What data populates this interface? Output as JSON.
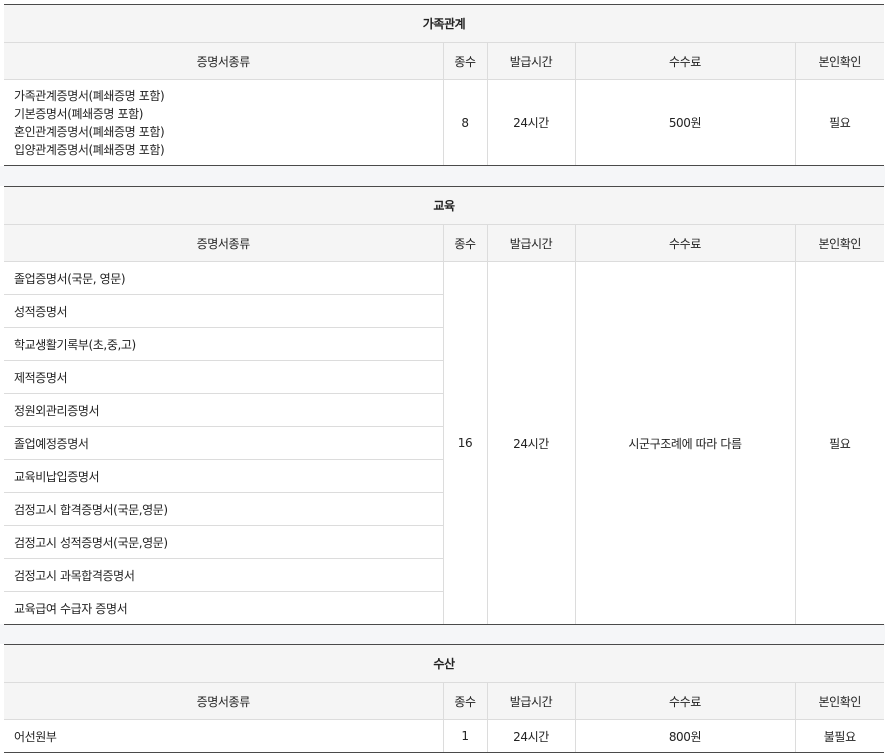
{
  "columns": {
    "doc_type": "증명서종류",
    "count": "종수",
    "issue_time": "발급시간",
    "fee": "수수료",
    "id_check": "본인확인"
  },
  "sections": [
    {
      "title": "가족관계",
      "documents": [
        "가족관계증명서(폐쇄증명 포함)",
        "기본증명서(폐쇄증명 포함)",
        "혼인관계증명서(폐쇄증명 포함)",
        "입양관계증명서(폐쇄증명 포함)"
      ],
      "count": "8",
      "issue_time": "24시간",
      "fee": "500원",
      "id_check": "필요"
    },
    {
      "title": "교육",
      "documents": [
        "졸업증명서(국문, 영문)",
        "성적증명서",
        "학교생활기록부(초,중,고)",
        "제적증명서",
        "정원외관리증명서",
        "졸업예정증명서",
        "교육비납입증명서",
        "검정고시 합격증명서(국문,영문)",
        "검정고시 성적증명서(국문,영문)",
        "검정고시 과목합격증명서",
        "교육급여 수급자 증명서"
      ],
      "count": "16",
      "issue_time": "24시간",
      "fee": "시군구조례에 따라 다름",
      "id_check": "필요"
    },
    {
      "title": "수산",
      "documents": [
        "어선원부"
      ],
      "count": "1",
      "issue_time": "24시간",
      "fee": "800원",
      "id_check": "불필요"
    }
  ]
}
